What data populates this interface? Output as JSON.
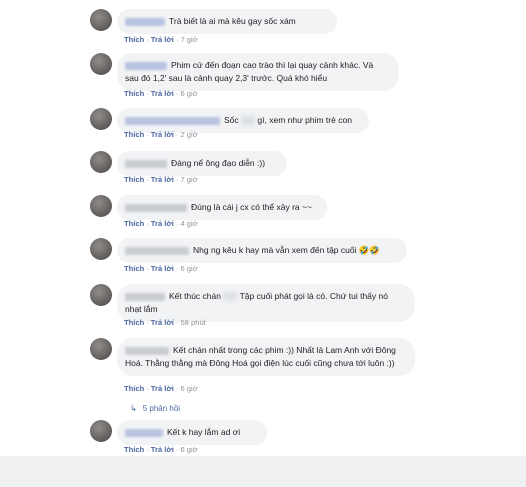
{
  "comments": [
    {
      "text": "Trà biết là ai mà kêu gay sốc xám",
      "like": "Thích",
      "reply": "Trả lời",
      "time": "7 giờ"
    },
    {
      "text": "Phim cứ đến đoạn cao trào thì lại quay cảnh khác. Và sau đó 1,2' sau là cảnh quay 2,3' trước. Quá khó hiểu",
      "like": "Thích",
      "reply": "Trả lời",
      "time": "6 giờ"
    },
    {
      "text_before": "Sốc",
      "text_after": "gì, xem như phim trẻ con",
      "like": "Thích",
      "reply": "Trả lời",
      "time": "2 giờ"
    },
    {
      "text": "Đáng nể ông đạo diễn :))",
      "like": "Thích",
      "reply": "Trả lời",
      "time": "7 giờ"
    },
    {
      "text": "Đúng là cái j cx có thể xảy ra ~~",
      "like": "Thích",
      "reply": "Trả lời",
      "time": "4 giờ"
    },
    {
      "text": "Nhg ng kêu k hay mà vẫn xem đến tập cuối 🤣🤣",
      "like": "Thích",
      "reply": "Trả lời",
      "time": "6 giờ"
    },
    {
      "text_before": "Kết thúc chán",
      "text_after": "Tập cuối phát gọi là có. Chứ tui thấy nó nhạt lắm",
      "like": "Thích",
      "reply": "Trả lời",
      "time": "58 phút"
    },
    {
      "text": "Kết chán nhất trong các phim :)) Nhất là Lam Anh với Đông Hoá. Thằng thằng mà Đông Hoá gọi điện lúc cuối cũng chưa tới luôn :))",
      "like": "Thích",
      "reply": "Trả lời",
      "time": "6 giờ"
    },
    {
      "text": "Kết k hay lắm ad ơi",
      "like": "Thích",
      "reply": "Trả lời",
      "time": "6 giờ"
    }
  ],
  "replies_link": {
    "arrow": "↳",
    "label": "5 phản hồi"
  },
  "colors": {
    "link": "#4b67a1",
    "bubble": "#f2f3f5",
    "meta": "#90949c",
    "text": "#1c1e21",
    "footer": "#f0f1f3"
  }
}
